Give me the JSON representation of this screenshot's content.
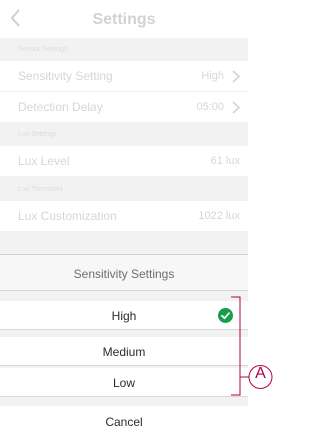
{
  "header": {
    "title": "Settings"
  },
  "sections": {
    "sensor": "Sensor Settings",
    "lux": "Lux Settings",
    "lux_threshold": "Lux Threshold"
  },
  "rows": {
    "sensitivity": {
      "label": "Sensitivity Setting",
      "value": "High"
    },
    "detection_delay": {
      "label": "Detection Delay",
      "value": "05:00"
    },
    "lux_level": {
      "label": "Lux Level",
      "value": "61 lux"
    },
    "lux_customization": {
      "label": "Lux Customization",
      "value": "1022 lux"
    }
  },
  "sheet": {
    "title": "Sensitivity Settings",
    "options": [
      {
        "label": "High",
        "selected": true
      },
      {
        "label": "Medium",
        "selected": false
      },
      {
        "label": "Low",
        "selected": false
      }
    ],
    "cancel_label": "Cancel"
  },
  "callout": {
    "letter": "A"
  },
  "colors": {
    "accent_check": "#169e4c",
    "callout": "#b0004a"
  },
  "icons": {
    "back": "chevron-left-icon",
    "row_arrow": "chevron-right-icon",
    "selected": "checkmark-circle-icon"
  }
}
